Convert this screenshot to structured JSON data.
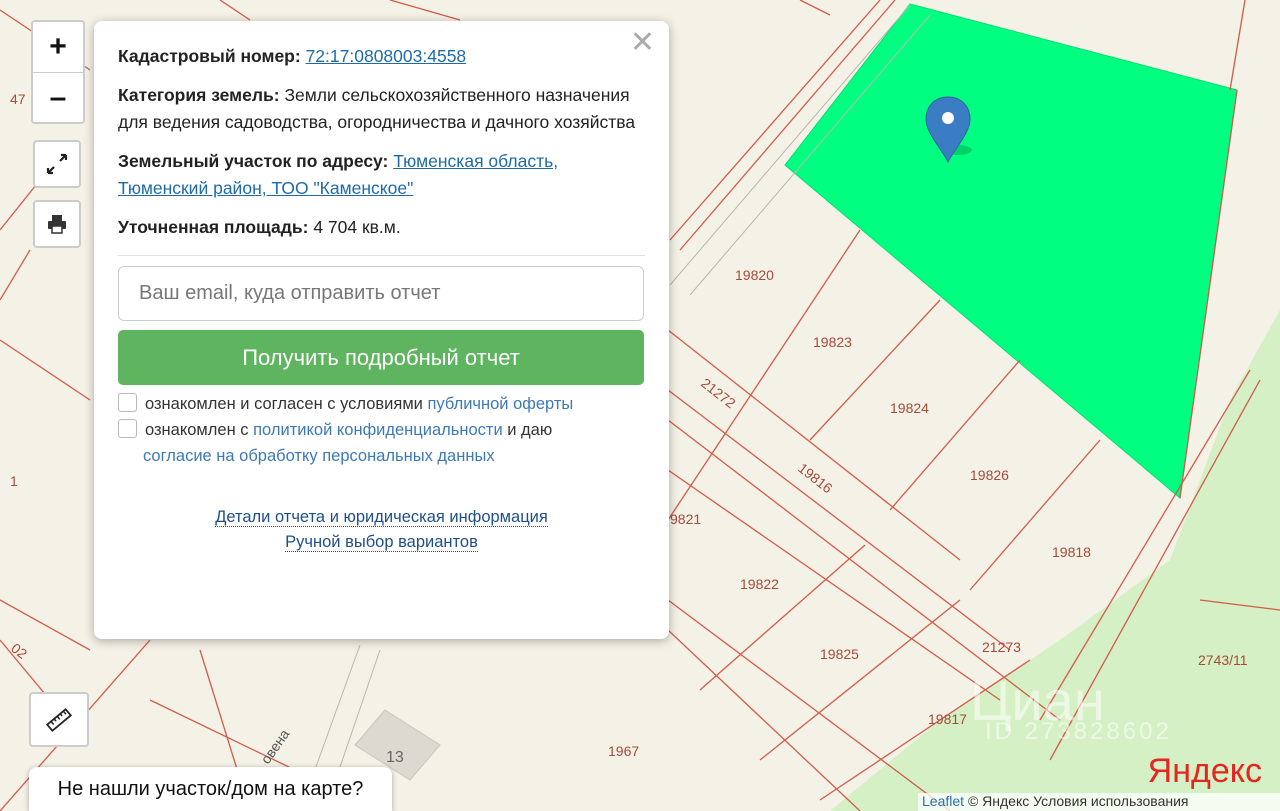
{
  "popup": {
    "cadastral_label": "Кадастровый номер:",
    "cadastral_number": "72:17:0808003:4558",
    "category_label": "Категория земель:",
    "category_value": "Земли сельскохозяйственного назначения",
    "permitted_use": "для ведения садоводства, огородничества и дачного хозяйства",
    "address_label": "Земельный участок по адресу:",
    "address_value": "Тюменская область, Тюменский район, ТОО \"Каменское\"",
    "area_label": "Уточненная площадь:",
    "area_value": "4 704 кв.м.",
    "email_placeholder": "Ваш email, куда отправить отчет",
    "submit_label": "Получить подробный отчет",
    "consent1_text": "ознакомлен и согласен с условиями",
    "consent1_link": "публичной оферты",
    "consent2_text_a": "ознакомлен с",
    "consent2_link_a": "политикой конфиденциальности",
    "consent2_text_b": "и даю",
    "consent2_link_b": "согласие на обработку персональных данных",
    "details_link": "Детали отчета и юридическая информация",
    "manual_link": "Ручной выбор вариантов",
    "close_icon": "close-icon"
  },
  "controls": {
    "zoom_in": "+",
    "zoom_out": "–",
    "fullscreen_icon": "fullscreen-icon",
    "print_icon": "printer-icon",
    "ruler_icon": "ruler-icon"
  },
  "not_found_label": "Не нашли участок/дом на карте?",
  "map": {
    "parcel_labels": [
      "19820",
      "19823",
      "19824",
      "19826",
      "19818",
      "19822",
      "19825",
      "21273",
      "19817",
      "1967",
      "2743/11",
      "9821",
      "21272",
      "19816"
    ],
    "edge_labels": [
      "47",
      "1",
      "02"
    ],
    "street_label": "овена",
    "building_number": "13",
    "highlight_color": "#00ff80",
    "green_area_color": "#d4f0c4",
    "marker_icon": "map-marker-icon"
  },
  "watermark": {
    "brand": "Циан",
    "id": "ID 273828602"
  },
  "attribution": {
    "leaflet": "Leaflet",
    "rest": "© Яндекс  Условия использования"
  },
  "yandex_logo": "Яндекс"
}
